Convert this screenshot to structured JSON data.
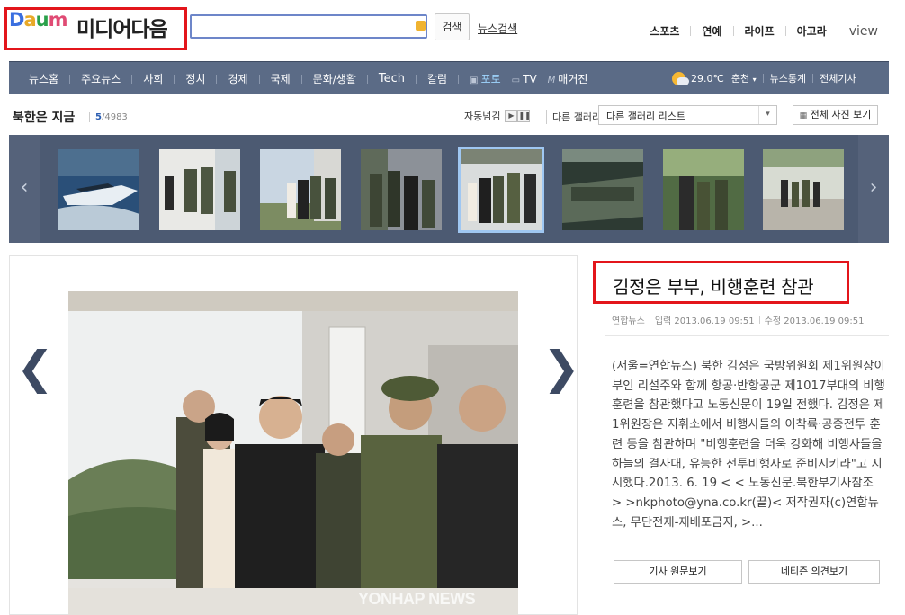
{
  "header": {
    "logo_letters": {
      "d": "D",
      "a": "a",
      "u": "u",
      "m": "m"
    },
    "logo_text": "미디어다음",
    "search_placeholder": "",
    "search_button": "검색",
    "news_search_link": "뉴스검색",
    "top_links": [
      "스포츠",
      "연예",
      "라이프",
      "아고라",
      "view"
    ]
  },
  "nav": {
    "items": [
      "뉴스홈",
      "주요뉴스",
      "사회",
      "정치",
      "경제",
      "국제",
      "문화/생활",
      "Tech",
      "칼럼"
    ],
    "photo": "포토",
    "tv": "TV",
    "magazine": "매거진",
    "weather_temp": "29.0℃",
    "weather_city": "춘천",
    "news_stats": "뉴스통계",
    "all_articles": "전체기사"
  },
  "gallery": {
    "title": "북한은 지금",
    "current": "5",
    "total": "/4983",
    "autoplay_label": "자동넘김",
    "other_gallery_label": "다른 갤러리",
    "select_value": "다른 갤러리 리스트",
    "all_photos_button": "전체 사진 보기",
    "thumbnail_count": 8,
    "selected_index": 4
  },
  "article": {
    "headline": "김정은 부부, 비행훈련 참관",
    "source": "연합뉴스",
    "posted": "입력 2013.06.19 09:51",
    "modified": "수정 2013.06.19 09:51",
    "body": "(서울=연합뉴스) 북한 김정은 국방위원회 제1위원장이 부인 리설주와 함께 항공·반항공군 제1017부대의 비행훈련을 참관했다고 노동신문이 19일 전했다. 김정은 제1위원장은 지휘소에서 비행사들의 이착륙·공중전투 훈련 등을 참관하며 \"비행훈련을 더욱 강화해 비행사들을 하늘의 결사대, 유능한 전투비행사로 준비시키라\"고 지시했다.2013. 6. 19 < < 노동신문.북한부기사참조 > >nkphoto@yna.co.kr(끝)< 저작권자(c)연합뉴스, 무단전재-재배포금지, >...",
    "btn_original": "기사 원문보기",
    "btn_comments": "네티즌 의견보기",
    "watermark": "YONHAP NEWS"
  },
  "colors": {
    "nav_bg": "#5b6b86",
    "strip_bg": "#4c5a72",
    "highlight_red": "#e3151b",
    "photo_active": "#9fd6ff"
  }
}
